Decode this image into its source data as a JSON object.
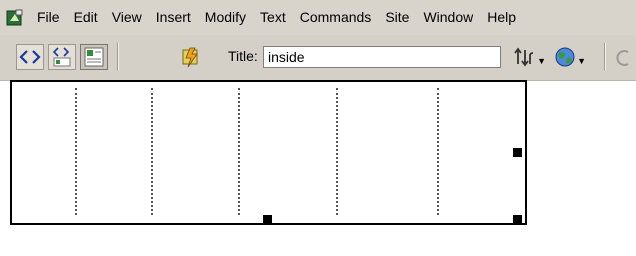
{
  "menubar": {
    "app_icon": "dreamweaver-icon",
    "items": [
      {
        "label": "File",
        "name": "menu-file"
      },
      {
        "label": "Edit",
        "name": "menu-edit"
      },
      {
        "label": "View",
        "name": "menu-view"
      },
      {
        "label": "Insert",
        "name": "menu-insert"
      },
      {
        "label": "Modify",
        "name": "menu-modify"
      },
      {
        "label": "Text",
        "name": "menu-text"
      },
      {
        "label": "Commands",
        "name": "menu-commands"
      },
      {
        "label": "Site",
        "name": "menu-site"
      },
      {
        "label": "Window",
        "name": "menu-window"
      },
      {
        "label": "Help",
        "name": "menu-help"
      }
    ]
  },
  "toolbar": {
    "buttons": [
      {
        "name": "code-view-button",
        "icon": "code-view-icon"
      },
      {
        "name": "split-view-button",
        "icon": "split-view-icon"
      },
      {
        "name": "design-view-button",
        "icon": "design-view-icon"
      },
      {
        "name": "live-data-button",
        "icon": "live-data-icon"
      }
    ],
    "title_label": "Title:",
    "title_value": "inside",
    "file_management_icon": "file-management-icon",
    "preview_icon": "globe-icon",
    "refresh_icon": "refresh-icon"
  },
  "colors": {
    "chrome": "#d4d0c8",
    "canvas": "#ffffff",
    "table_border": "#000000"
  }
}
